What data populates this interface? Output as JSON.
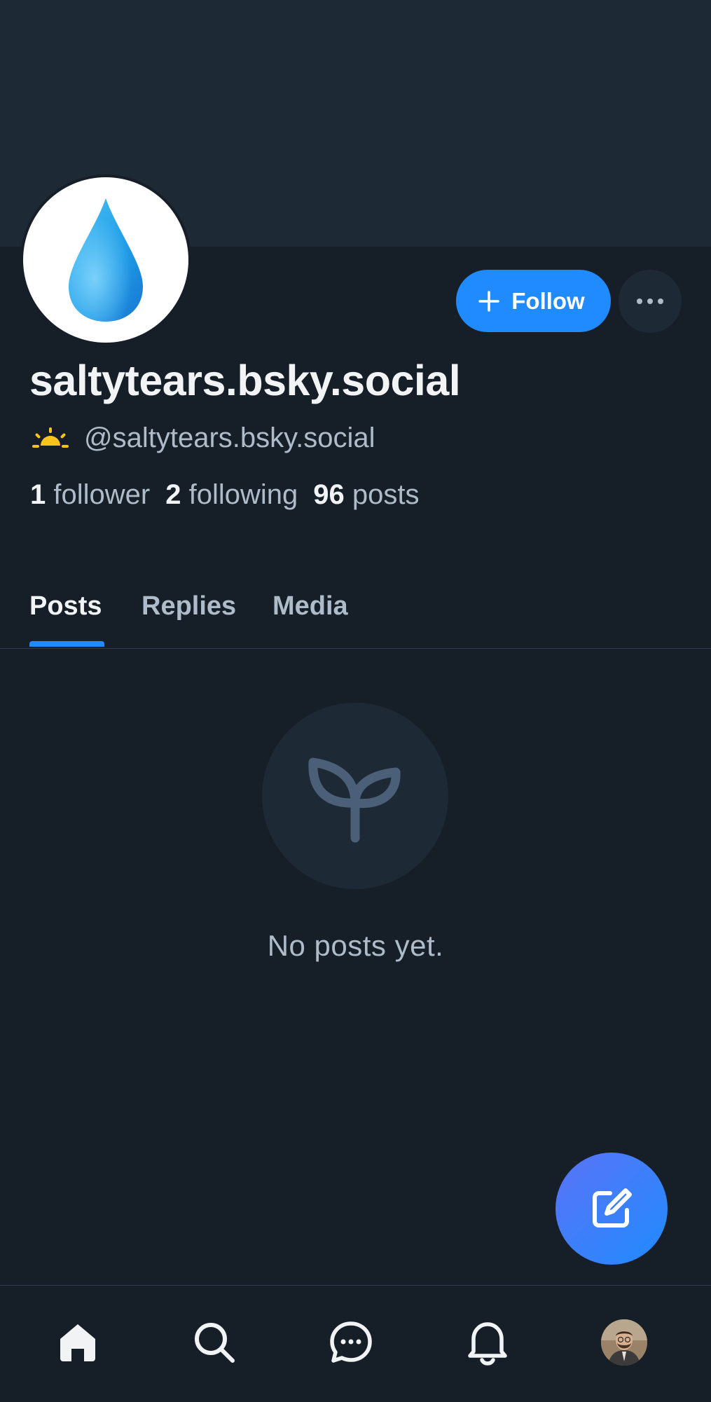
{
  "profile": {
    "display_name": "saltytears.bsky.social",
    "handle": "@saltytears.bsky.social",
    "stats": {
      "followers_count": "1",
      "followers_label": "follower",
      "following_count": "2",
      "following_label": "following",
      "posts_count": "96",
      "posts_label": "posts"
    }
  },
  "actions": {
    "follow_label": "Follow"
  },
  "tabs": [
    {
      "label": "Posts",
      "active": true
    },
    {
      "label": "Replies",
      "active": false
    },
    {
      "label": "Media",
      "active": false
    }
  ],
  "feed": {
    "empty_message": "No posts yet."
  },
  "icons": {
    "avatar": "water-drop-icon",
    "handle_badge": "sunrise-icon",
    "follow": "plus-icon",
    "more": "ellipsis-icon",
    "empty": "seedling-icon",
    "compose": "compose-icon",
    "nav": [
      "home-icon",
      "search-icon",
      "chat-icon",
      "bell-icon",
      "profile-avatar"
    ]
  },
  "colors": {
    "background": "#161e27",
    "banner": "#1e2936",
    "accent": "#208bfe",
    "text_primary": "#f1f3f5",
    "text_secondary": "#aebbc9"
  }
}
